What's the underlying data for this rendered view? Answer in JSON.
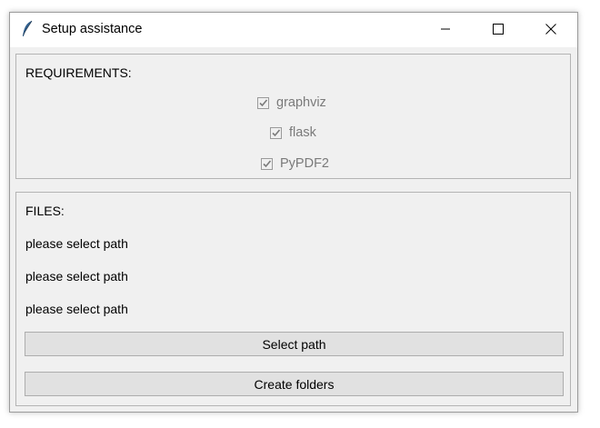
{
  "window": {
    "title": "Setup assistance",
    "icon": "feather-icon",
    "controls": [
      "minimize-icon",
      "maximize-icon",
      "close-icon"
    ]
  },
  "requirements": {
    "label": "REQUIREMENTS:",
    "items": [
      {
        "label": "graphviz",
        "checked": true,
        "enabled": false
      },
      {
        "label": "flask",
        "checked": true,
        "enabled": false
      },
      {
        "label": "PyPDF2",
        "checked": true,
        "enabled": false
      }
    ]
  },
  "files": {
    "label": "FILES:",
    "paths": [
      "please select path",
      "please select path",
      "please select path"
    ],
    "select_button": "Select path",
    "create_button": "Create folders"
  },
  "colors": {
    "window_bg": "#f0f0f0",
    "titlebar_bg": "#ffffff",
    "button_bg": "#e1e1e1",
    "disabled_text": "#7a7a7a"
  }
}
